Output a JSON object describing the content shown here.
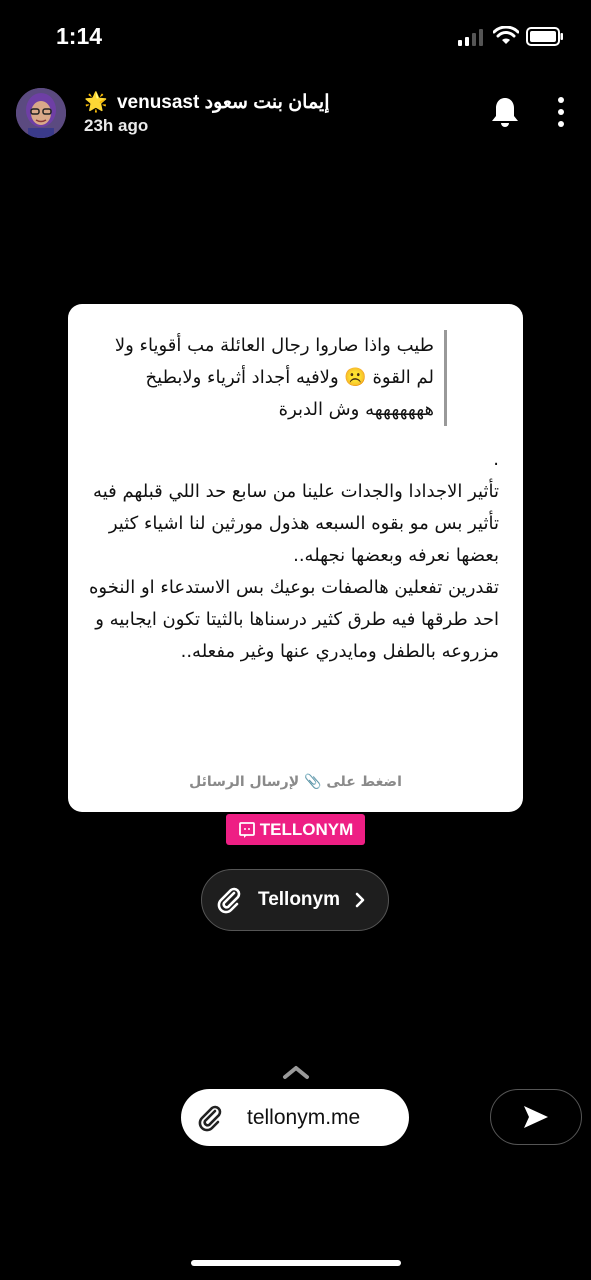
{
  "status_bar": {
    "time": "1:14"
  },
  "header": {
    "star": "🌟",
    "username": "venusast إيمان بنت سعود",
    "time_ago": "23h ago"
  },
  "card": {
    "quote": "طيب واذا صاروا رجال العائلة مب أقوياء ولا لم القوة ☹️ ولافيه أجداد أثرياء ولابطيخ هههههههه وش الدبرة",
    "body": ".\nتأثير الاجدادا والجدات علينا من سابع حد اللي قبلهم فيه تأثير بس مو بقوه السبعه هذول مورثين لنا اشياء كثير بعضها نعرفه وبعضها نجهله..\nتقدرين تفعلين هالصفات بوعيك بس الاستدعاء او النخوه احد طرقها فيه طرق كثير درسناها بالثيتا تكون ايجابيه و مزروعه بالطفل ومايدري عنها وغير مفعله..",
    "hint": "اضغط على 📎 لإرسال الرسائل"
  },
  "brand_badge": "TELLONYM",
  "link_pill": {
    "label": "Tellonym"
  },
  "url_pill": {
    "label": "tellonym.me"
  },
  "colors": {
    "brand": "#ee1f84",
    "background": "#000000"
  }
}
